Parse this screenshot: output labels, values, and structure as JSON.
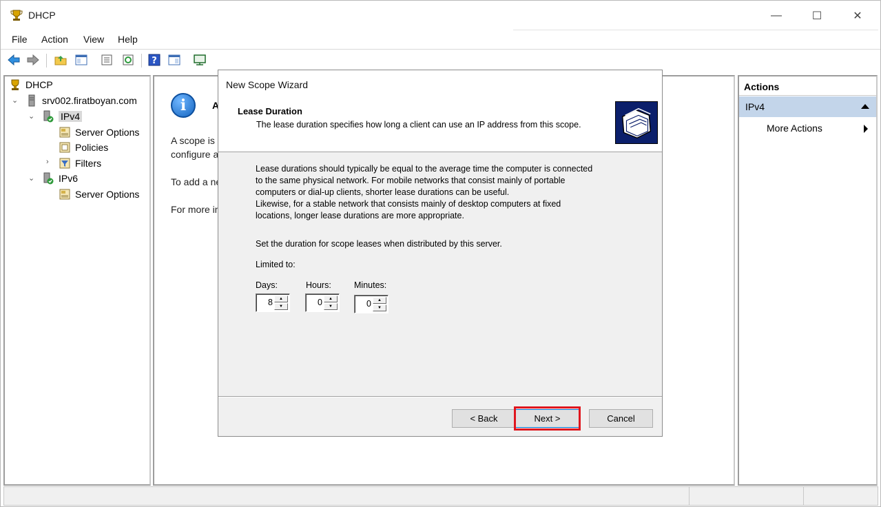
{
  "window": {
    "title": "DHCP",
    "controls": {
      "minimize": "—",
      "maximize": "☐",
      "close": "✕"
    }
  },
  "menubar": {
    "items": [
      "File",
      "Action",
      "View",
      "Help"
    ]
  },
  "toolbar": {
    "buttons": [
      "back-arrow-icon",
      "forward-arrow-icon",
      "up-folder-icon",
      "show-hide-tree-icon",
      "properties-icon",
      "refresh-icon",
      "help-icon",
      "show-hide-action-pane-icon",
      "server-monitor-icon"
    ]
  },
  "tree": {
    "root": "DHCP",
    "server": "srv002.firatboyan.com",
    "ipv4": "IPv4",
    "ipv4_children": [
      "Server Options",
      "Policies",
      "Filters"
    ],
    "ipv6": "IPv6",
    "ipv6_children": [
      "Server Options"
    ]
  },
  "center": {
    "heading_initial": "A",
    "lines": [
      "A scope is a",
      "configure a",
      "To add a ne",
      "For more in"
    ]
  },
  "actions": {
    "header": "Actions",
    "section": "IPv4",
    "items": [
      "More Actions"
    ]
  },
  "wizard": {
    "title": "New Scope Wizard",
    "header_title": "Lease Duration",
    "header_subtitle": "The lease duration specifies how long a client can use an IP address from this scope.",
    "paragraph": [
      "Lease durations should typically be equal to the average time the computer is connected",
      "to the same physical network. For mobile networks that consist mainly of portable",
      "computers or dial-up clients, shorter lease durations can be useful.",
      "Likewise, for a stable network that consists mainly of desktop computers at fixed",
      "locations, longer lease durations are more appropriate."
    ],
    "instruction": "Set the duration for scope leases when distributed by this server.",
    "limited_to": "Limited to:",
    "days_label": "Days:",
    "hours_label": "Hours:",
    "minutes_label": "Minutes:",
    "days_value": "8",
    "hours_value": "0",
    "minutes_value": "0",
    "back_button": "< Back",
    "next_button": "Next >",
    "cancel_button": "Cancel",
    "highlight_color": "#e0161e"
  }
}
